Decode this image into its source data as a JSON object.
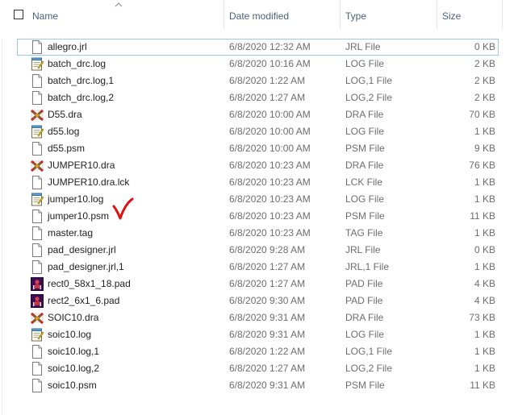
{
  "columns": {
    "name": "Name",
    "date": "Date modified",
    "type": "Type",
    "size": "Size"
  },
  "colors": {
    "header_text": "#4c607a",
    "detail_text": "#6d6d6d",
    "selection_border": "#99c9ef",
    "annotation": "#e01010"
  },
  "files": [
    {
      "name": "allegro.jrl",
      "date": "6/8/2020 12:32 AM",
      "type": "JRL File",
      "size": "0 KB",
      "icon": "blank-file-icon"
    },
    {
      "name": "batch_drc.log",
      "date": "6/8/2020 10:16 AM",
      "type": "LOG File",
      "size": "2 KB",
      "icon": "notepad-log-icon"
    },
    {
      "name": "batch_drc.log,1",
      "date": "6/8/2020 1:22 AM",
      "type": "LOG,1 File",
      "size": "2 KB",
      "icon": "blank-file-icon"
    },
    {
      "name": "batch_drc.log,2",
      "date": "6/8/2020 1:27 AM",
      "type": "LOG,2 File",
      "size": "2 KB",
      "icon": "blank-file-icon"
    },
    {
      "name": "D55.dra",
      "date": "6/8/2020 10:00 AM",
      "type": "DRA File",
      "size": "70 KB",
      "icon": "allegro-dra-icon"
    },
    {
      "name": "d55.log",
      "date": "6/8/2020 10:00 AM",
      "type": "LOG File",
      "size": "1 KB",
      "icon": "notepad-log-icon"
    },
    {
      "name": "d55.psm",
      "date": "6/8/2020 10:00 AM",
      "type": "PSM File",
      "size": "9 KB",
      "icon": "blank-file-icon"
    },
    {
      "name": "JUMPER10.dra",
      "date": "6/8/2020 10:23 AM",
      "type": "DRA File",
      "size": "76 KB",
      "icon": "allegro-dra-icon"
    },
    {
      "name": "JUMPER10.dra.lck",
      "date": "6/8/2020 10:23 AM",
      "type": "LCK File",
      "size": "1 KB",
      "icon": "blank-file-icon"
    },
    {
      "name": "jumper10.log",
      "date": "6/8/2020 10:23 AM",
      "type": "LOG File",
      "size": "1 KB",
      "icon": "notepad-log-icon"
    },
    {
      "name": "jumper10.psm",
      "date": "6/8/2020 10:23 AM",
      "type": "PSM File",
      "size": "11 KB",
      "icon": "blank-file-icon"
    },
    {
      "name": "master.tag",
      "date": "6/8/2020 10:23 AM",
      "type": "TAG File",
      "size": "1 KB",
      "icon": "blank-file-icon"
    },
    {
      "name": "pad_designer.jrl",
      "date": "6/8/2020 9:28 AM",
      "type": "JRL File",
      "size": "0 KB",
      "icon": "blank-file-icon"
    },
    {
      "name": "pad_designer.jrl,1",
      "date": "6/8/2020 1:27 AM",
      "type": "JRL,1 File",
      "size": "1 KB",
      "icon": "blank-file-icon"
    },
    {
      "name": "rect0_58x1_18.pad",
      "date": "6/8/2020 1:27 AM",
      "type": "PAD File",
      "size": "4 KB",
      "icon": "pad-designer-icon"
    },
    {
      "name": "rect2_6x1_6.pad",
      "date": "6/8/2020 9:30 AM",
      "type": "PAD File",
      "size": "4 KB",
      "icon": "pad-designer-icon"
    },
    {
      "name": "SOIC10.dra",
      "date": "6/8/2020 9:31 AM",
      "type": "DRA File",
      "size": "73 KB",
      "icon": "allegro-dra-icon"
    },
    {
      "name": "soic10.log",
      "date": "6/8/2020 9:31 AM",
      "type": "LOG File",
      "size": "1 KB",
      "icon": "notepad-log-icon"
    },
    {
      "name": "soic10.log,1",
      "date": "6/8/2020 1:22 AM",
      "type": "LOG,1 File",
      "size": "1 KB",
      "icon": "blank-file-icon"
    },
    {
      "name": "soic10.log,2",
      "date": "6/8/2020 1:27 AM",
      "type": "LOG,2 File",
      "size": "1 KB",
      "icon": "blank-file-icon"
    },
    {
      "name": "soic10.psm",
      "date": "6/8/2020 9:31 AM",
      "type": "PSM File",
      "size": "11 KB",
      "icon": "blank-file-icon"
    }
  ]
}
